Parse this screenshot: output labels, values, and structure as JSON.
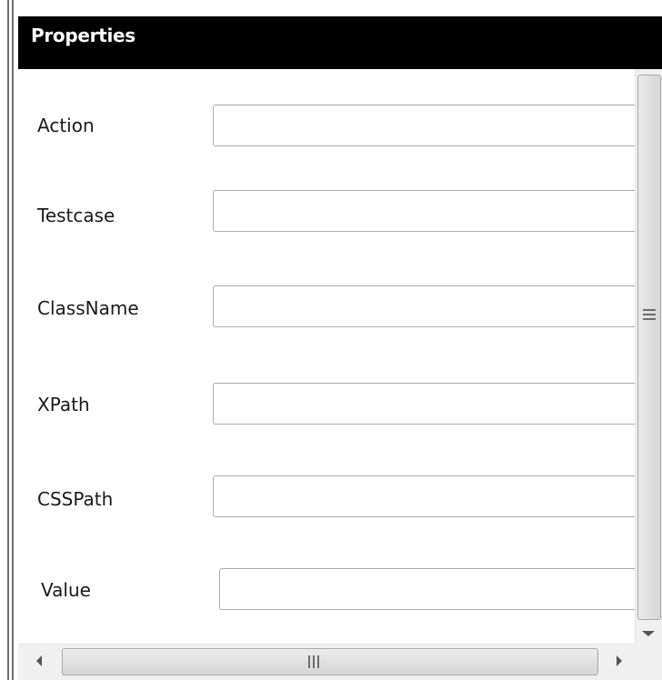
{
  "panel": {
    "title": "Properties"
  },
  "fields": [
    {
      "label": "Action",
      "value": ""
    },
    {
      "label": "Testcase",
      "value": ""
    },
    {
      "label": "ClassName",
      "value": ""
    },
    {
      "label": "XPath",
      "value": ""
    },
    {
      "label": "CSSPath",
      "value": ""
    },
    {
      "label": "Value",
      "value": ""
    }
  ],
  "icons": {
    "scroll_down": "chevron-down-icon",
    "scroll_left": "chevron-left-icon",
    "scroll_right": "chevron-right-icon"
  },
  "colors": {
    "header_background": "#000000",
    "header_text": "#ffffff",
    "input_border": "#abadb3",
    "scrollbar_track": "#f0f0f0"
  }
}
